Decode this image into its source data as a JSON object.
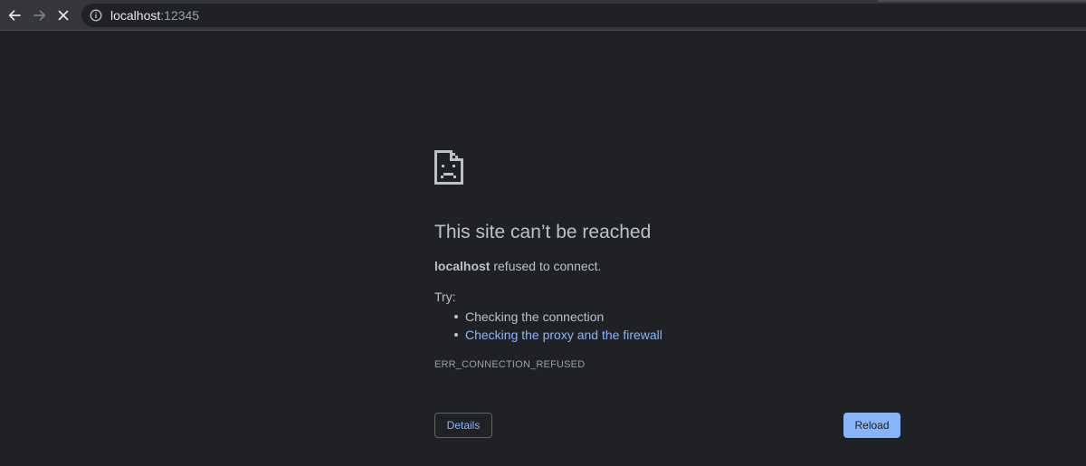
{
  "browser": {
    "url_host": "localhost",
    "url_port": ":12345",
    "icons": {
      "back": "arrow-left-icon",
      "forward": "arrow-right-icon",
      "stop": "close-icon",
      "site_info": "info-icon"
    }
  },
  "error_page": {
    "icon": "sad-document-icon",
    "heading": "This site can’t be reached",
    "host": "localhost",
    "summary_suffix": " refused to connect.",
    "try_label": "Try:",
    "suggestions": [
      "Checking the connection",
      "Checking the proxy and the firewall"
    ],
    "error_code": "ERR_CONNECTION_REFUSED",
    "details_label": "Details",
    "reload_label": "Reload"
  },
  "colors": {
    "background": "#202124",
    "toolbar": "#35363a",
    "text": "#bdc1c6",
    "link": "#8ab4f8",
    "primary_button": "#8ab4f8"
  }
}
